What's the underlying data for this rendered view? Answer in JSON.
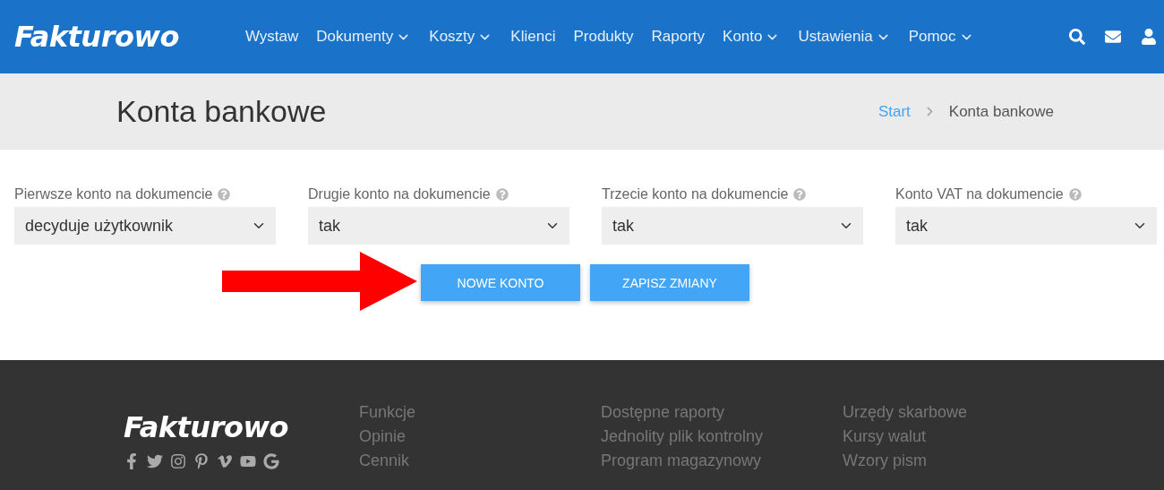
{
  "header": {
    "logo": "Fakturowo",
    "nav": [
      {
        "label": "Wystaw",
        "dropdown": false
      },
      {
        "label": "Dokumenty",
        "dropdown": true
      },
      {
        "label": "Koszty",
        "dropdown": true
      },
      {
        "label": "Klienci",
        "dropdown": false
      },
      {
        "label": "Produkty",
        "dropdown": false
      },
      {
        "label": "Raporty",
        "dropdown": false
      },
      {
        "label": "Konto",
        "dropdown": true
      },
      {
        "label": "Ustawienia",
        "dropdown": true
      },
      {
        "label": "Pomoc",
        "dropdown": true
      }
    ]
  },
  "page": {
    "title": "Konta bankowe",
    "breadcrumb": [
      {
        "label": "Start",
        "link": true
      },
      {
        "label": "Konta bankowe",
        "link": false
      }
    ]
  },
  "settings": [
    {
      "label": "Pierwsze konto na dokumencie",
      "value": "decyduje użytkownik"
    },
    {
      "label": "Drugie konto na dokumencie",
      "value": "tak"
    },
    {
      "label": "Trzecie konto na dokumencie",
      "value": "tak"
    },
    {
      "label": "Konto VAT na dokumencie",
      "value": "tak"
    }
  ],
  "buttons": [
    "NOWE KONTO",
    "ZAPISZ ZMIANY"
  ],
  "footer": {
    "logo": "Fakturowo",
    "columns": [
      [
        "Funkcje",
        "Opinie",
        "Cennik"
      ],
      [
        "Dostępne raporty",
        "Jednolity plik kontrolny",
        "Program magazynowy"
      ],
      [
        "Urzędy skarbowe",
        "Kursy walut",
        "Wzory pism"
      ]
    ]
  }
}
